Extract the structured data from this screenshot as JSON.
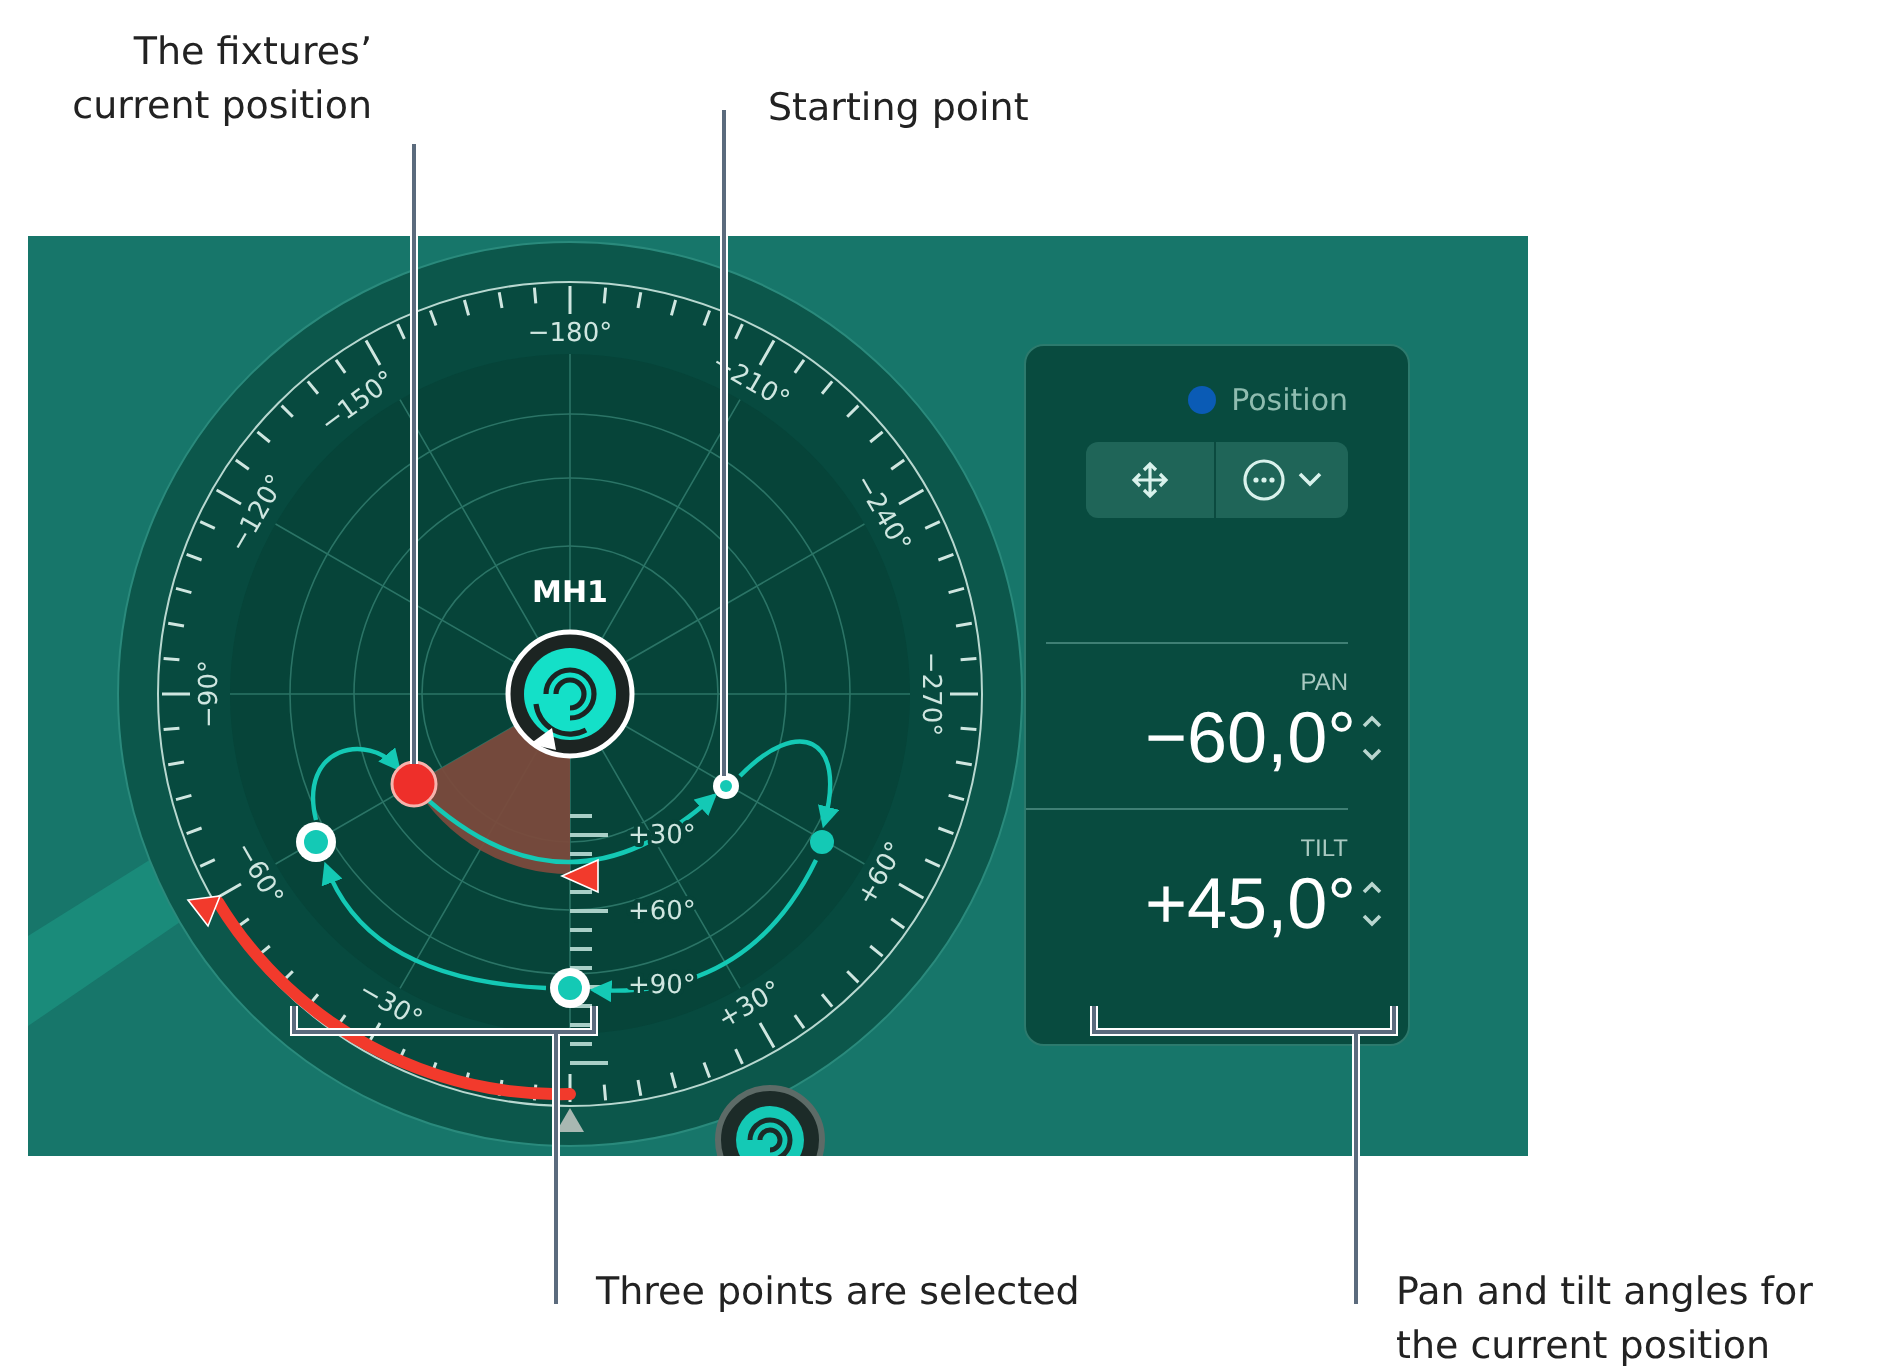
{
  "callouts": [
    {
      "text": "The fixtures’\ncurrent position"
    },
    {
      "text": "Starting point"
    },
    {
      "text": "Three points are selected"
    },
    {
      "text": "Pan and tilt angles for\nthe current position"
    }
  ],
  "dial": {
    "fixture_label": "MH1",
    "pan_scale": [
      "−180°",
      "−150°",
      "−120°",
      "−90°",
      "−60°",
      "−30°",
      "−210°",
      "−240°",
      "−270°",
      "+60°",
      "+30°"
    ],
    "tilt_scale": [
      "+30°",
      "+60°",
      "+90°"
    ],
    "points": [
      {
        "kind": "current",
        "selected": false
      },
      {
        "kind": "point",
        "selected": true
      },
      {
        "kind": "point",
        "selected": true
      },
      {
        "kind": "point",
        "selected": false
      },
      {
        "kind": "start",
        "selected": true
      }
    ]
  },
  "panel": {
    "status": {
      "label": "Position",
      "color": "#0a5bb5"
    },
    "pan": {
      "label": "PAN",
      "value": "−60,0°"
    },
    "tilt": {
      "label": "TILT",
      "value": "+45,0°"
    }
  }
}
